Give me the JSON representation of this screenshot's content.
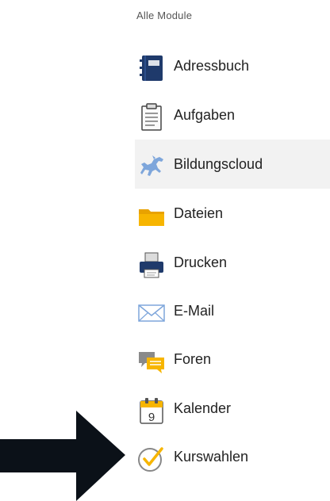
{
  "sidebar": {
    "section_title": "Alle Module",
    "items": [
      {
        "label": "Adressbuch",
        "icon": "address-book-icon"
      },
      {
        "label": "Aufgaben",
        "icon": "clipboard-icon"
      },
      {
        "label": "Bildungscloud",
        "icon": "horse-icon",
        "active": true
      },
      {
        "label": "Dateien",
        "icon": "folder-icon"
      },
      {
        "label": "Drucken",
        "icon": "printer-icon"
      },
      {
        "label": "E-Mail",
        "icon": "envelope-icon"
      },
      {
        "label": "Foren",
        "icon": "chat-bubbles-icon"
      },
      {
        "label": "Kalender",
        "icon": "calendar-icon",
        "calendar_day": "9"
      },
      {
        "label": "Kurswahlen",
        "icon": "checkmark-circle-icon"
      }
    ]
  },
  "annotation": {
    "icon": "pointer-arrow-icon",
    "color": "#0b1118"
  },
  "colors": {
    "navy": "#1f3a6b",
    "folder": "#f7b500",
    "horse": "#7ea6db",
    "highlight": "#f2f2f2"
  }
}
